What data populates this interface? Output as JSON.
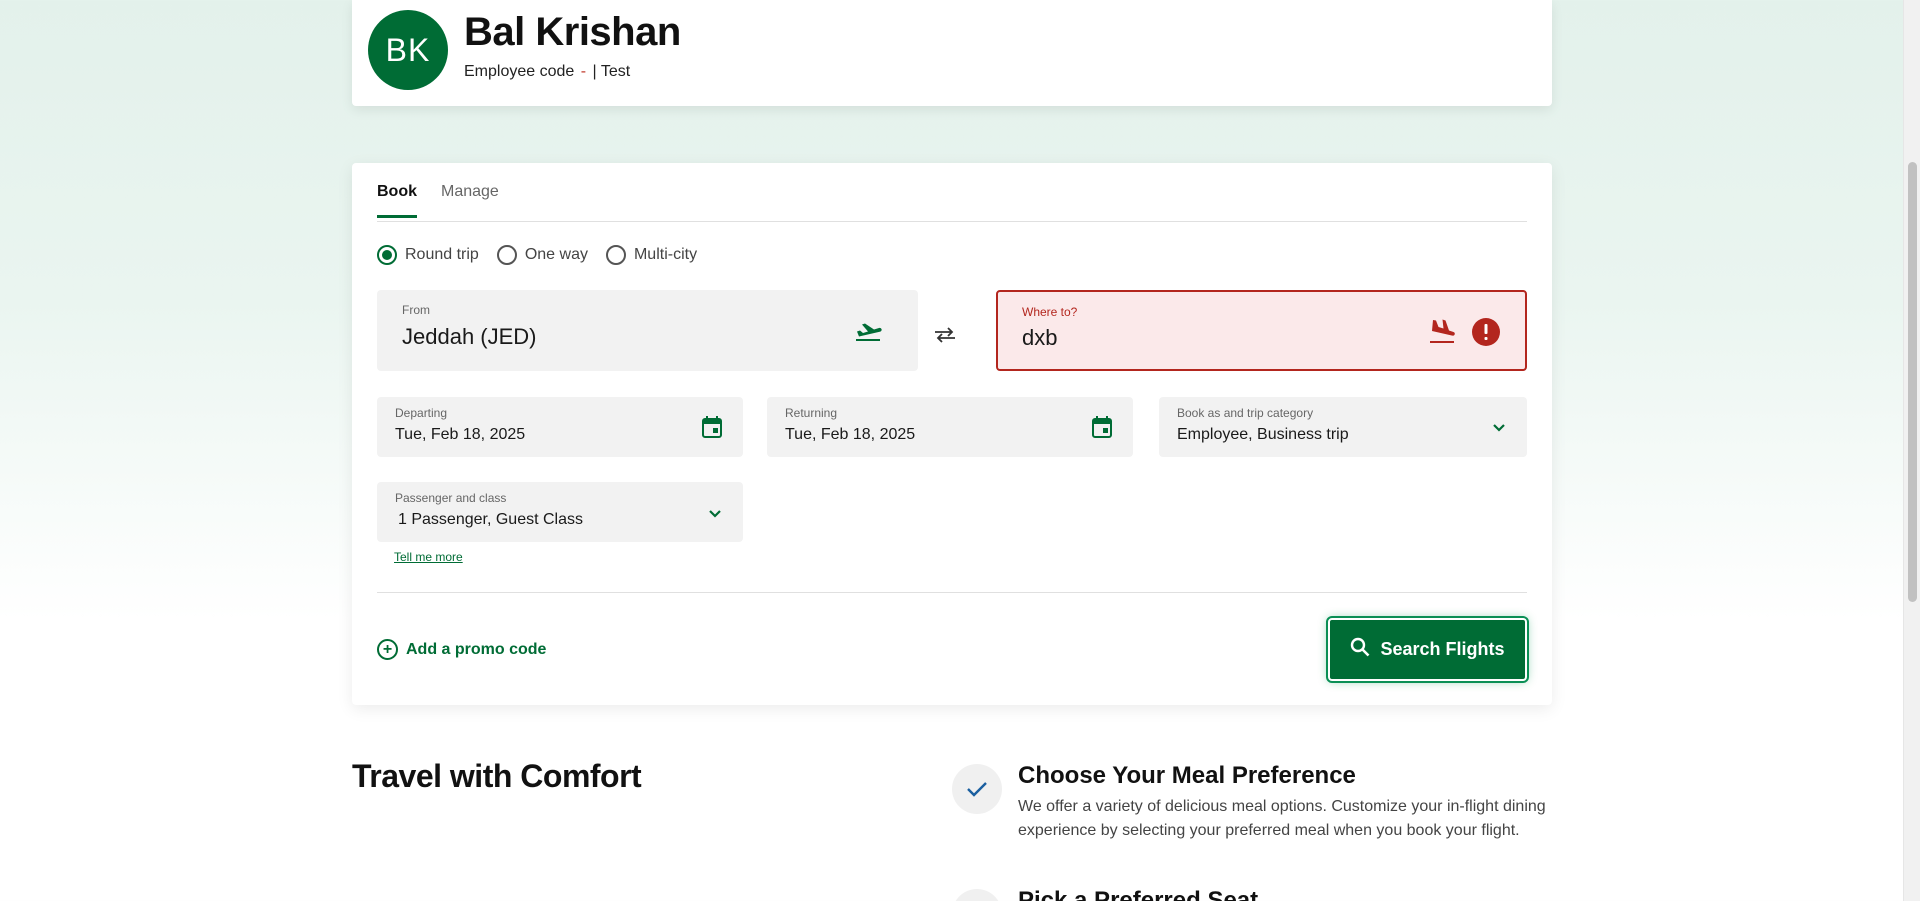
{
  "profile": {
    "initials": "BK",
    "name": "Bal Krishan",
    "code_label": "Employee code",
    "code_separator": "-",
    "code_suffix": "| Test"
  },
  "booking": {
    "tabs": [
      {
        "label": "Book",
        "active": true
      },
      {
        "label": "Manage",
        "active": false
      }
    ],
    "trip_types": [
      {
        "label": "Round trip",
        "selected": true
      },
      {
        "label": "One way",
        "selected": false
      },
      {
        "label": "Multi-city",
        "selected": false
      }
    ],
    "from": {
      "label": "From",
      "value": "Jeddah (JED)",
      "icon": "plane-takeoff-icon"
    },
    "swap_icon": "swap-icon",
    "to": {
      "label": "Where to?",
      "value": "dxb",
      "icon": "plane-landing-icon",
      "error_icon": "error-icon"
    },
    "departing": {
      "label": "Departing",
      "value": "Tue, Feb 18, 2025",
      "icon": "calendar-icon"
    },
    "returning": {
      "label": "Returning",
      "value": "Tue, Feb 18, 2025",
      "icon": "calendar-icon"
    },
    "category": {
      "label": "Book as and trip category",
      "value": "Employee, Business trip",
      "icon": "chevron-down-icon"
    },
    "passenger": {
      "label": "Passenger and class",
      "value": "1 Passenger, Guest Class",
      "icon": "chevron-down-icon"
    },
    "tell_more": "Tell me more",
    "promo_label": "Add a promo code",
    "search_label": "Search Flights"
  },
  "comfort": {
    "title": "Travel with Comfort",
    "features": [
      {
        "title": "Choose Your Meal Preference",
        "description": "We offer a variety of delicious meal options. Customize your in-flight dining experience by selecting your preferred meal when you book your flight."
      },
      {
        "title": "Pick a Preferred Seat"
      }
    ]
  },
  "colors": {
    "brand_green": "#006c35",
    "error_red": "#b3261e",
    "error_bg": "#fbe9ea"
  }
}
